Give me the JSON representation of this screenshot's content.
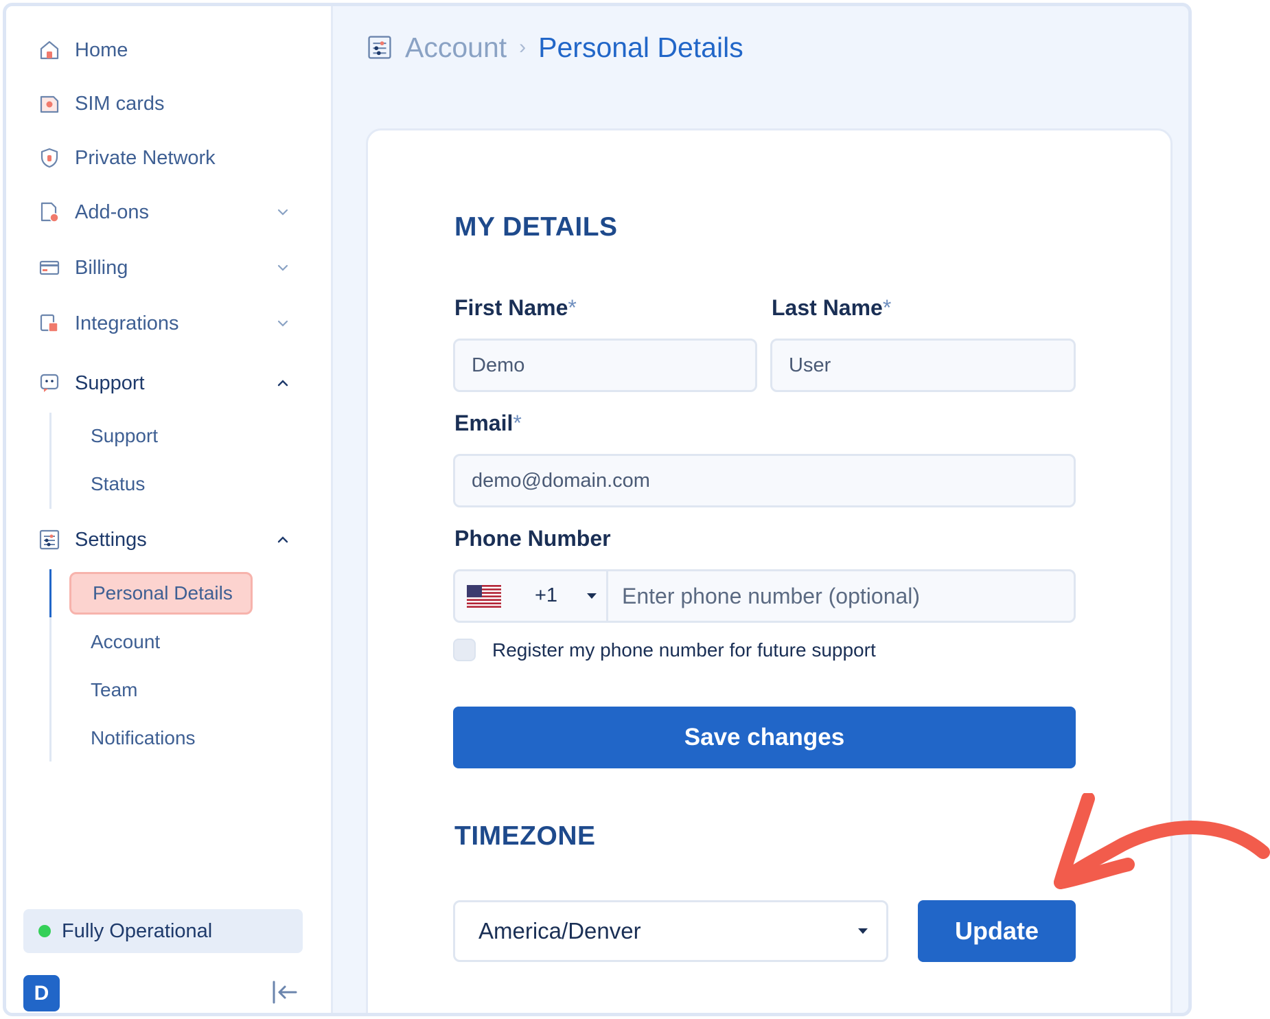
{
  "sidebar": {
    "items": [
      {
        "label": "Home",
        "icon": "home-icon"
      },
      {
        "label": "SIM cards",
        "icon": "sim-card-icon"
      },
      {
        "label": "Private Network",
        "icon": "shield-icon"
      },
      {
        "label": "Add-ons",
        "icon": "document-plus-icon",
        "expandable": true,
        "expanded": false
      },
      {
        "label": "Billing",
        "icon": "credit-card-icon",
        "expandable": true,
        "expanded": false
      },
      {
        "label": "Integrations",
        "icon": "integrations-icon",
        "expandable": true,
        "expanded": false
      },
      {
        "label": "Support",
        "icon": "support-chat-icon",
        "expandable": true,
        "expanded": true
      },
      {
        "label": "Settings",
        "icon": "settings-sliders-icon",
        "expandable": true,
        "expanded": true
      }
    ],
    "support_sub": [
      {
        "label": "Support"
      },
      {
        "label": "Status"
      }
    ],
    "settings_sub": [
      {
        "label": "Personal Details",
        "active": true
      },
      {
        "label": "Account"
      },
      {
        "label": "Team"
      },
      {
        "label": "Notifications"
      }
    ],
    "status_text": "Fully Operational",
    "status_color": "#34d058",
    "avatar_initial": "D"
  },
  "breadcrumb": {
    "parent": "Account",
    "current": "Personal Details"
  },
  "form": {
    "section_title": "MY DETAILS",
    "first_name_label": "First Name",
    "last_name_label": "Last Name",
    "email_label": "Email",
    "required_mark": "*",
    "first_name_value": "Demo",
    "last_name_value": "User",
    "email_value": "demo@domain.com",
    "phone_label": "Phone Number",
    "country_code": "+1",
    "phone_placeholder": "Enter phone number (optional)",
    "register_label": "Register my phone number for future support",
    "register_checked": false,
    "save_label": "Save changes"
  },
  "timezone": {
    "section_title": "TIMEZONE",
    "selected": "America/Denver",
    "update_label": "Update"
  },
  "colors": {
    "accent": "#2166c8",
    "annotation": "#f25c4c",
    "highlight": "#fcd3cf"
  }
}
